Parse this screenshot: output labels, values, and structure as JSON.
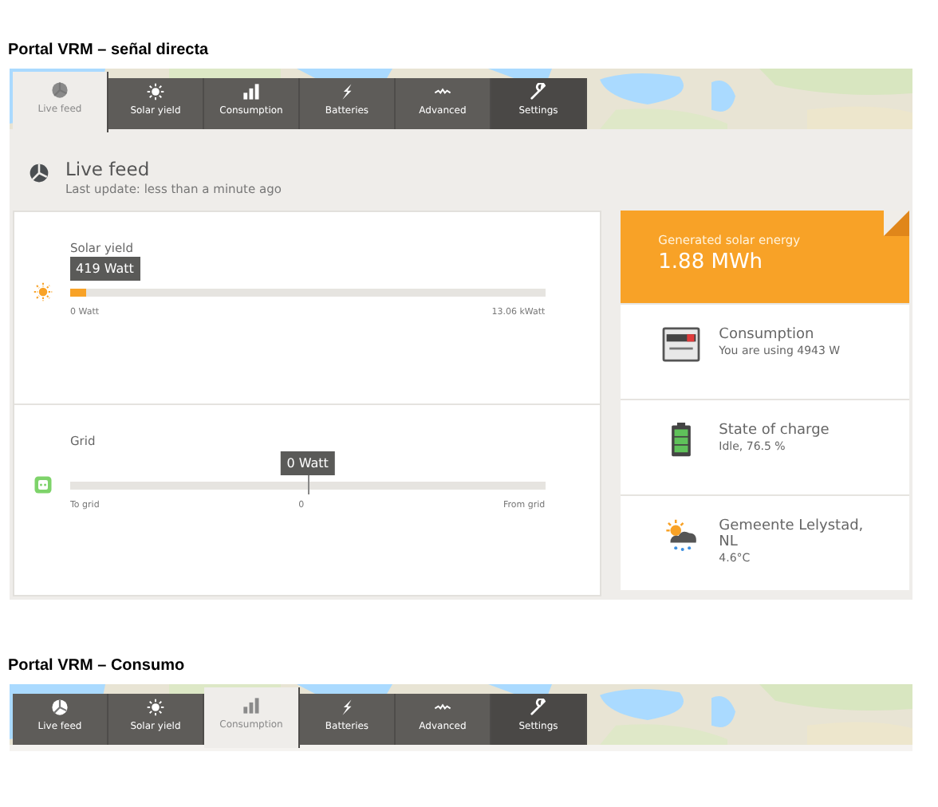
{
  "screens": [
    {
      "heading": "Portal VRM – señal directa",
      "tabs": [
        {
          "kind": "live",
          "label": "Live feed",
          "selected": true
        },
        {
          "kind": "solar",
          "label": "Solar yield",
          "selected": false
        },
        {
          "kind": "consumption",
          "label": "Consumption",
          "selected": false
        },
        {
          "kind": "batteries",
          "label": "Batteries",
          "selected": false
        },
        {
          "kind": "advanced",
          "label": "Advanced",
          "selected": false
        },
        {
          "kind": "settings",
          "label": "Settings",
          "selected": false
        }
      ],
      "page": {
        "title": "Live feed",
        "subtitle": "Last update: less than a minute ago",
        "meters": [
          {
            "kind": "solar",
            "title": "Solar yield",
            "tooltip": "419 Watt",
            "level": 0.032,
            "labels": [
              "0 Watt",
              "13.06 kWatt"
            ]
          },
          {
            "kind": "grid",
            "title": "Grid",
            "tooltip": "0 Watt",
            "level": 0.5,
            "labels": [
              "To grid",
              "0",
              "From grid"
            ]
          }
        ],
        "summary": {
          "label": "Generated solar energy",
          "value": "1.88 MWh"
        },
        "items": [
          {
            "kind": "meter",
            "title": "Consumption",
            "detail": "You are using 4943 W"
          },
          {
            "kind": "battery",
            "title": "State of charge",
            "detail": "Idle, 76.5 %"
          },
          {
            "kind": "weather",
            "title": "Gemeente Lelystad, NL",
            "detail": "4.6°C"
          }
        ]
      }
    },
    {
      "heading": "Portal VRM – Consumo",
      "tabs": [
        {
          "kind": "live",
          "label": "Live feed",
          "selected": false
        },
        {
          "kind": "solar",
          "label": "Solar yield",
          "selected": false
        },
        {
          "kind": "consumption",
          "label": "Consumption",
          "selected": true
        },
        {
          "kind": "batteries",
          "label": "Batteries",
          "selected": false
        },
        {
          "kind": "advanced",
          "label": "Advanced",
          "selected": false
        },
        {
          "kind": "settings",
          "label": "Settings",
          "selected": false
        }
      ]
    }
  ]
}
